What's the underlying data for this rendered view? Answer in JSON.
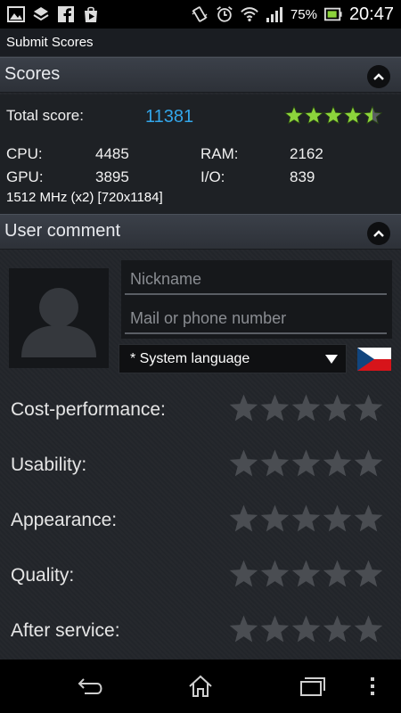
{
  "status_bar": {
    "battery_percent": "75%",
    "time": "20:47",
    "left_icons": [
      "gallery-icon",
      "checklist-icon",
      "facebook-icon",
      "play-store-icon"
    ],
    "right_icons": [
      "vibrate-icon",
      "alarm-icon",
      "wifi-icon",
      "signal-icon",
      "battery-icon"
    ]
  },
  "title_bar": {
    "title": "Submit Scores"
  },
  "scores": {
    "header": "Scores",
    "total_label": "Total score:",
    "total_value": "11381",
    "star_rating": 4.5,
    "cpu_label": "CPU:",
    "cpu_value": "4485",
    "ram_label": "RAM:",
    "ram_value": "2162",
    "gpu_label": "GPU:",
    "gpu_value": "3895",
    "io_label": "I/O:",
    "io_value": "839",
    "specs": "1512 MHz (x2) [720x1184]"
  },
  "user_comment": {
    "header": "User comment",
    "nickname_placeholder": "Nickname",
    "contact_placeholder": "Mail or phone number",
    "language_value": "* System language"
  },
  "ratings": [
    {
      "label": "Cost-performance:",
      "value": 0
    },
    {
      "label": "Usability:",
      "value": 0
    },
    {
      "label": "Appearance:",
      "value": 0
    },
    {
      "label": "Quality:",
      "value": 0
    },
    {
      "label": "After service:",
      "value": 0
    }
  ],
  "colors": {
    "accent_blue": "#33a6ea",
    "star_green": "#8dd43c",
    "star_empty": "#4a4d52"
  }
}
